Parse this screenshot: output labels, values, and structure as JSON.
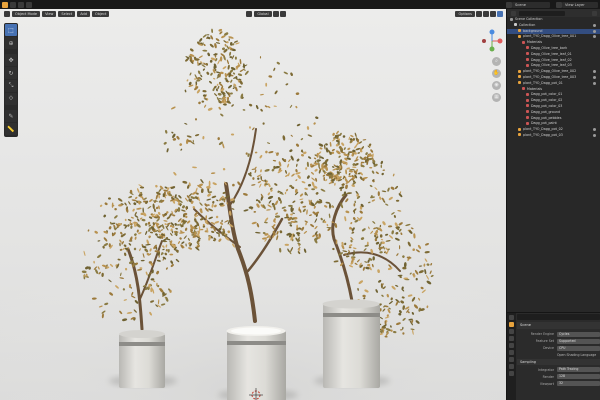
{
  "topbar": {
    "scene_label": "Scene",
    "view_layer_label": "View Layer",
    "tabs": [
      "",
      "",
      "",
      ""
    ]
  },
  "viewport": {
    "mode": "Object Mode",
    "menus": [
      "View",
      "Select",
      "Add",
      "Object"
    ],
    "transform": "Global",
    "options": "Options"
  },
  "outliner": {
    "title": "Scene Collection",
    "rows": [
      {
        "label": "Scene Collection",
        "indent": 0,
        "color": "#9a9a9a",
        "sel": false
      },
      {
        "label": "Collection",
        "indent": 1,
        "color": "#cccccc",
        "sel": false
      },
      {
        "label": "background",
        "indent": 2,
        "color": "#e8a33d",
        "sel": true
      },
      {
        "label": "plant_TYO_Dagg_Olive_tree_001",
        "indent": 2,
        "color": "#e8a33d",
        "sel": false
      },
      {
        "label": "Materials",
        "indent": 3,
        "color": "#cc5555",
        "sel": false
      },
      {
        "label": "Dagg_Olive_tree_bark",
        "indent": 4,
        "color": "#cc5555",
        "sel": false
      },
      {
        "label": "Dagg_Olive_tree_leaf_01",
        "indent": 4,
        "color": "#cc5555",
        "sel": false
      },
      {
        "label": "Dagg_Olive_tree_leaf_02",
        "indent": 4,
        "color": "#cc5555",
        "sel": false
      },
      {
        "label": "Dagg_Olive_tree_leaf_03",
        "indent": 4,
        "color": "#cc5555",
        "sel": false
      },
      {
        "label": "plant_TYO_Dagg_Olive_tree_002",
        "indent": 2,
        "color": "#e8a33d",
        "sel": false
      },
      {
        "label": "plant_TYO_Dagg_Olive_tree_003",
        "indent": 2,
        "color": "#e8a33d",
        "sel": false
      },
      {
        "label": "plant_TYO_Dagg_pot_01",
        "indent": 2,
        "color": "#e8a33d",
        "sel": false
      },
      {
        "label": "Materials",
        "indent": 3,
        "color": "#cc5555",
        "sel": false
      },
      {
        "label": "Dagg_pot_color_01",
        "indent": 4,
        "color": "#cc5555",
        "sel": false
      },
      {
        "label": "Dagg_pot_color_02",
        "indent": 4,
        "color": "#cc5555",
        "sel": false
      },
      {
        "label": "Dagg_pot_color_03",
        "indent": 4,
        "color": "#cc5555",
        "sel": false
      },
      {
        "label": "Dagg_pot_ground",
        "indent": 4,
        "color": "#cc5555",
        "sel": false
      },
      {
        "label": "Dagg_pot_pebbles",
        "indent": 4,
        "color": "#cc5555",
        "sel": false
      },
      {
        "label": "Dagg_pot_paint",
        "indent": 4,
        "color": "#cc5555",
        "sel": false
      },
      {
        "label": "plant_TYO_Dagg_pot_02",
        "indent": 2,
        "color": "#e8a33d",
        "sel": false
      },
      {
        "label": "plant_TYO_Dagg_pot_03",
        "indent": 2,
        "color": "#e8a33d",
        "sel": false
      }
    ]
  },
  "properties": {
    "section_title": "Scene",
    "render_engine_label": "Render Engine",
    "render_engine_value": "Cycles",
    "feature_set_label": "Feature Set",
    "feature_set_value": "Supported",
    "device_label": "Device",
    "device_value": "CPU",
    "osl_label": "Open Shading Language",
    "sampling_label": "Sampling",
    "integrator_label": "Integrator",
    "integrator_value": "Path Tracing",
    "render_label": "Render",
    "render_value": "128",
    "viewport_label": "Viewport",
    "viewport_value": "32"
  },
  "colors": {
    "accent": "#e8a33d",
    "selection": "#334d80",
    "active_tool": "#4772b3"
  }
}
